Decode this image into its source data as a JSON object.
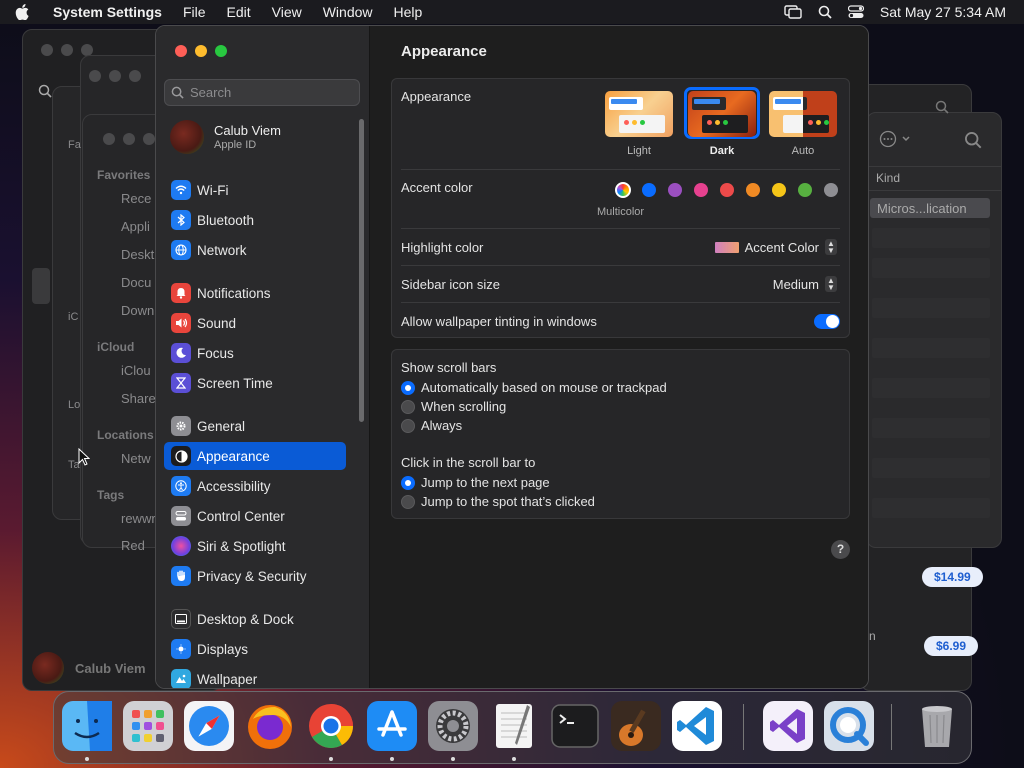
{
  "menubar": {
    "app_name": "System Settings",
    "items": [
      "File",
      "Edit",
      "View",
      "Window",
      "Help"
    ],
    "clock": "Sat May 27  5:34 AM"
  },
  "background": {
    "finder": {
      "favorites": "Favorites",
      "fav_items": [
        "Rece",
        "Appli",
        "Deskt",
        "Docu",
        "Down"
      ],
      "icloud": "iCloud",
      "icloud_items": [
        "iClou",
        "Share"
      ],
      "locations": "Locations",
      "loc_items": [
        "Netw"
      ],
      "tags": "Tags",
      "tag_items": [
        "rewwr",
        "Red"
      ],
      "frag_fa": "Fa",
      "frag_ic": "iC",
      "frag_lo": "Lo",
      "frag_ta": "Ta",
      "user_name": "Calub Viem"
    },
    "store": {
      "kind_header": "Kind",
      "kind_value": "Micros...lication",
      "price1": "$14.99",
      "price2": "$6.99",
      "frag_n": "n"
    }
  },
  "sidebar": {
    "search_placeholder": "Search",
    "account": {
      "name": "Calub Viem",
      "subtitle": "Apple ID"
    },
    "items": [
      {
        "label": "Wi-Fi",
        "icon": "wifi-icon",
        "color": "#1e7bf2"
      },
      {
        "label": "Bluetooth",
        "icon": "bluetooth-icon",
        "color": "#1e7bf2"
      },
      {
        "label": "Network",
        "icon": "globe-icon",
        "color": "#1e7bf2"
      },
      {
        "label": "Notifications",
        "icon": "bell-icon",
        "color": "#e8453c"
      },
      {
        "label": "Sound",
        "icon": "speaker-icon",
        "color": "#e8453c"
      },
      {
        "label": "Focus",
        "icon": "moon-icon",
        "color": "#5b4fd6"
      },
      {
        "label": "Screen Time",
        "icon": "hourglass-icon",
        "color": "#5b4fd6"
      },
      {
        "label": "General",
        "icon": "gear-icon",
        "color": "#8e8e93"
      },
      {
        "label": "Appearance",
        "icon": "appearance-icon",
        "color": "#1c1c1e"
      },
      {
        "label": "Accessibility",
        "icon": "accessibility-icon",
        "color": "#1e7bf2"
      },
      {
        "label": "Control Center",
        "icon": "control-center-icon",
        "color": "#8e8e93"
      },
      {
        "label": "Siri & Spotlight",
        "icon": "siri-icon",
        "color": "#b040c8"
      },
      {
        "label": "Privacy & Security",
        "icon": "hand-icon",
        "color": "#1e7bf2"
      },
      {
        "label": "Desktop & Dock",
        "icon": "dock-icon",
        "color": "#2c2c2e"
      },
      {
        "label": "Displays",
        "icon": "display-icon",
        "color": "#1e7bf2"
      },
      {
        "label": "Wallpaper",
        "icon": "wallpaper-icon",
        "color": "#30a8e0"
      }
    ],
    "selected": "Appearance"
  },
  "content": {
    "title": "Appearance",
    "appearance": {
      "label": "Appearance",
      "options": [
        "Light",
        "Dark",
        "Auto"
      ],
      "selected": "Dark"
    },
    "accent": {
      "label": "Accent color",
      "selected_name": "Multicolor",
      "colors": [
        "#0a6cff",
        "#9b4fc0",
        "#e6418f",
        "#ec4a4a",
        "#f08a24",
        "#f5c518",
        "#57b040",
        "#8e8e93"
      ]
    },
    "highlight": {
      "label": "Highlight color",
      "value": "Accent Color"
    },
    "icon_size": {
      "label": "Sidebar icon size",
      "value": "Medium"
    },
    "tinting": {
      "label": "Allow wallpaper tinting in windows",
      "enabled": true
    },
    "scroll_bars": {
      "label": "Show scroll bars",
      "options": [
        "Automatically based on mouse or trackpad",
        "When scrolling",
        "Always"
      ],
      "selected_index": 0
    },
    "click_scroll": {
      "label": "Click in the scroll bar to",
      "options": [
        "Jump to the next page",
        "Jump to the spot that’s clicked"
      ],
      "selected_index": 0
    },
    "help": "?"
  },
  "dock": {
    "apps": [
      {
        "name": "finder-icon",
        "color": "#2d8ef0"
      },
      {
        "name": "launchpad-icon",
        "color": "#c8c8cc"
      },
      {
        "name": "safari-icon",
        "color": "#2a7ef0"
      },
      {
        "name": "firefox-icon",
        "color": "#f0700a"
      },
      {
        "name": "chrome-icon",
        "color": "#ffffff"
      },
      {
        "name": "app-store-icon",
        "color": "#1e8cf5"
      },
      {
        "name": "system-settings-icon",
        "color": "#8e8e93"
      },
      {
        "name": "textedit-icon",
        "color": "#f2f2f2"
      },
      {
        "name": "terminal-icon",
        "color": "#1c1c1e"
      },
      {
        "name": "garageband-icon",
        "color": "#3a2a20"
      },
      {
        "name": "vscode-icon",
        "color": "#ffffff"
      },
      {
        "name": "visual-studio-icon",
        "color": "#f4f0fa"
      },
      {
        "name": "quicktime-icon",
        "color": "#d8e0ea"
      },
      {
        "name": "trash-icon",
        "color": "#9a9a9e"
      }
    ]
  }
}
